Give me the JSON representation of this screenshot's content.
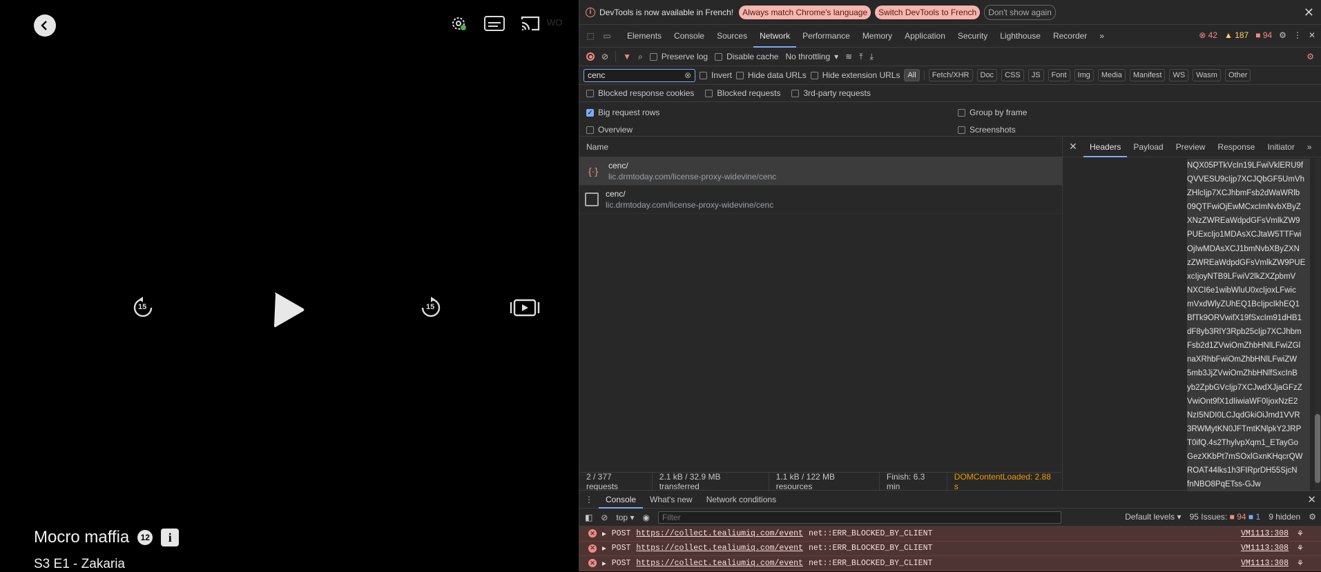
{
  "player": {
    "watermark": "WO",
    "skip_back_label": "15",
    "skip_forward_label": "15",
    "show_title": "Mocro maffia",
    "age_rating": "12",
    "info_label": "i",
    "episode": "S3 E1 - Zakaria"
  },
  "infobar": {
    "message": "DevTools is now available in French!",
    "btn_match": "Always match Chrome's language",
    "btn_switch": "Switch DevTools to French",
    "btn_dismiss": "Don't show again",
    "close": "✕"
  },
  "tabs": [
    "Elements",
    "Console",
    "Sources",
    "Network",
    "Performance",
    "Memory",
    "Application",
    "Security",
    "Lighthouse",
    "Recorder"
  ],
  "tab_overflow": "»",
  "counts": {
    "errors": "42",
    "warnings": "187",
    "issues": "94"
  },
  "toolbar": {
    "preserve_log": "Preserve log",
    "disable_cache": "Disable cache",
    "throttling": "No throttling"
  },
  "filter": {
    "value": "cenc",
    "invert": "Invert",
    "hide_data_urls": "Hide data URLs",
    "hide_extension_urls": "Hide extension URLs",
    "types": [
      "All",
      "Fetch/XHR",
      "Doc",
      "CSS",
      "JS",
      "Font",
      "Img",
      "Media",
      "Manifest",
      "WS",
      "Wasm",
      "Other"
    ]
  },
  "blocked": {
    "cookies": "Blocked response cookies",
    "requests": "Blocked requests",
    "third_party": "3rd-party requests"
  },
  "settings": {
    "big_rows": "Big request rows",
    "overview": "Overview",
    "group_by_frame": "Group by frame",
    "screenshots": "Screenshots"
  },
  "requests": {
    "header": "Name",
    "rows": [
      {
        "name": "cenc/",
        "url": "lic.drmtoday.com/license-proxy-widevine/cenc"
      },
      {
        "name": "cenc/",
        "url": "lic.drmtoday.com/license-proxy-widevine/cenc"
      }
    ]
  },
  "statusbar": {
    "requests": "2 / 377 requests",
    "transferred": "2.1 kB / 32.9 MB transferred",
    "resources": "1.1 kB / 122 MB resources",
    "finish": "Finish: 6.3 min",
    "dcl": "DOMContentLoaded: 2.88 s"
  },
  "detail": {
    "close": "✕",
    "tabs": [
      "Headers",
      "Payload",
      "Preview",
      "Response",
      "Initiator"
    ],
    "overflow": "»",
    "token_lines": [
      "NQX05PTkVcIn19LFwiVklERU9f",
      "QVVESU9cIjp7XCJQbGF5UmVh",
      "ZHlcIjp7XCJhbmFsb2dWaWRlb",
      "09QTFwiOjEwMCxcImNvbXByZ",
      "XNzZWREaWdpdGFsVmlkZW9",
      "PUExcIjo1MDAsXCJtaW5TTFwi",
      "OjIwMDAsXCJ1bmNvbXByZXN",
      "zZWREaWdpdGFsVmlkZW9PUE",
      "xcIjoyNTB9LFwiV2lkZXZpbmV",
      "NXCI6e1wibWluU0xcIjoxLFwic",
      "mVxdWlyZUhEQ1BcIjpcIkhEQ1",
      "BfTk9ORVwifX19fSxcIm91dHB1",
      "dF8yb3RlY3Rpb25cIjp7XCJhbm",
      "Fsb2d1ZVwiOmZhbHNlLFwiZGl",
      "naXRhbFwiOmZhbHNlLFwiZW",
      "5mb3JjZVwiOmZhbHNlfSxcInB",
      "yb2ZpbGVcIjp7XCJwdXJjaGFzZ",
      "VwiOnt9fX1dIiwiaWF0IjoxNzE2",
      "NzI5NDI0LCJqdGkiOiJmd1VVR",
      "3RWMytKN0JFTmtKNlpkY2JRP",
      "T0ifQ.4s2ThylvpXqm1_ETayGo",
      "GezXKbPt7mSOxlGxnKHqcrQW",
      "ROAT44lks1h3FIRprDH55SjcN",
      "fnNBO8PqETss-GJw"
    ]
  },
  "drawer": {
    "tabs": [
      "Console",
      "What's new",
      "Network conditions"
    ],
    "context": "top",
    "filter_placeholder": "Filter",
    "levels": "Default levels",
    "issues_label": "95 Issues:",
    "issues_err": "94",
    "issues_info": "1",
    "hidden": "9 hidden",
    "logs": [
      {
        "method": "POST",
        "url": "https://collect.tealiumiq.com/event",
        "error": "net::ERR_BLOCKED_BY_CLIENT",
        "source": "VM1113:308"
      },
      {
        "method": "POST",
        "url": "https://collect.tealiumiq.com/event",
        "error": "net::ERR_BLOCKED_BY_CLIENT",
        "source": "VM1113:308"
      },
      {
        "method": "POST",
        "url": "https://collect.tealiumiq.com/event",
        "error": "net::ERR_BLOCKED_BY_CLIENT",
        "source": "VM1113:308"
      }
    ]
  }
}
